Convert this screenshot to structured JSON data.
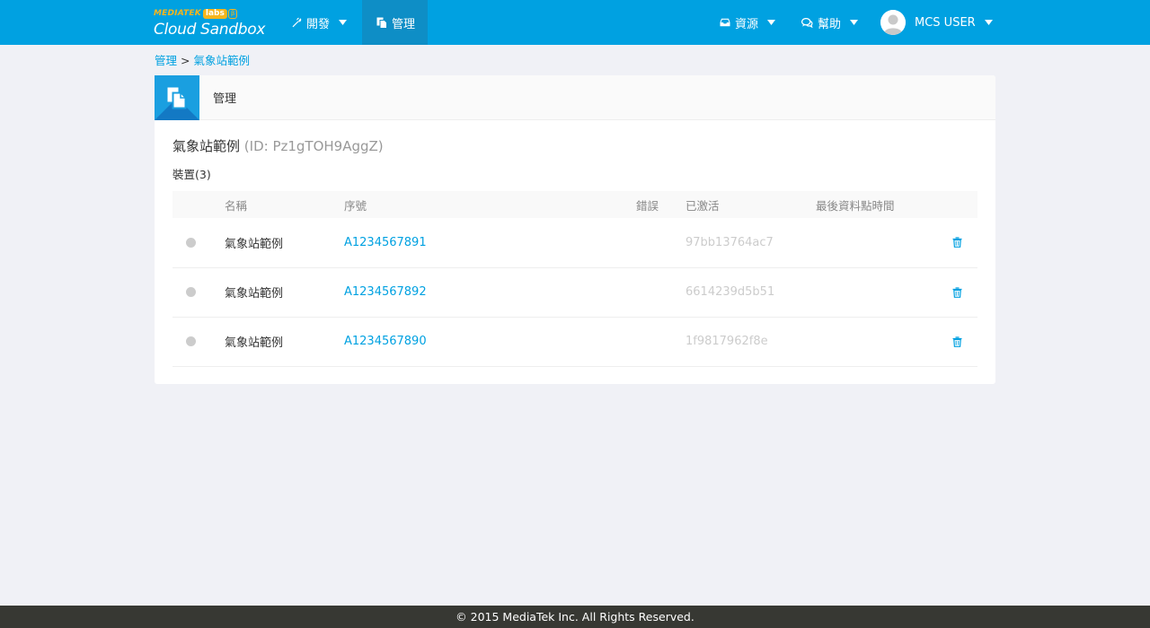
{
  "header": {
    "logo": {
      "brand": "MEDIATEK",
      "labs": "labs",
      "beta": "β",
      "product": "Cloud Sandbox"
    },
    "nav": {
      "develop": "開發",
      "manage": "管理",
      "resources": "資源",
      "help": "幫助",
      "user": "MCS USER"
    },
    "colors": {
      "bar": "#00a1e1",
      "active": "#0e8ec6"
    }
  },
  "breadcrumb": {
    "root": "管理",
    "separator": ">",
    "current": "氣象站範例"
  },
  "panel": {
    "title": "管理",
    "prototype_name": "氣象站範例",
    "prototype_id": "(ID: Pz1gTOH9AggZ)",
    "devices_label": "裝置(3)",
    "columns": [
      "名稱",
      "序號",
      "錯誤",
      "已激活",
      "最後資料點時間"
    ],
    "rows": [
      {
        "name": "氣象站範例",
        "serial": "A1234567891",
        "error": "",
        "activated": "97bb13764ac7",
        "last_datapoint": ""
      },
      {
        "name": "氣象站範例",
        "serial": "A1234567892",
        "error": "",
        "activated": "6614239d5b51",
        "last_datapoint": ""
      },
      {
        "name": "氣象站範例",
        "serial": "A1234567890",
        "error": "",
        "activated": "1f9817962f8e",
        "last_datapoint": ""
      }
    ]
  },
  "footer": {
    "text": "© 2015 MediaTek Inc. All Rights Reserved."
  }
}
